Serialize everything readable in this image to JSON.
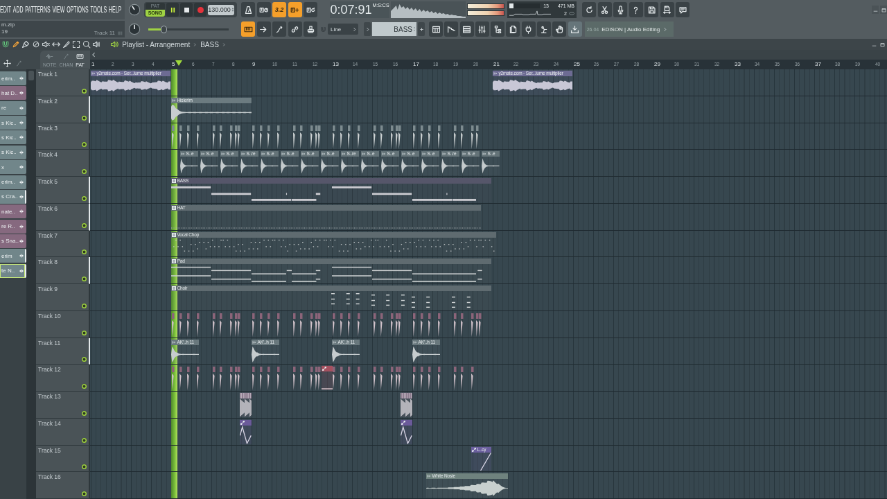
{
  "menu": [
    "EDIT",
    "ADD",
    "PATTERNS",
    "VIEW",
    "OPTIONS",
    "TOOLS",
    "HELP"
  ],
  "hint_panel": {
    "file": "m.zip",
    "line": "19",
    "target": "Track 11"
  },
  "transport": {
    "modes": [
      {
        "label": "PAT",
        "selected": false
      },
      {
        "label": "SONG",
        "selected": true
      }
    ],
    "playing": true,
    "tempo": "130.000"
  },
  "pitch_slider": {
    "level": 0.19
  },
  "record_buttons": [
    {
      "kind": "metronome",
      "on": false
    },
    {
      "kind": "keys-clock",
      "on": false
    },
    {
      "kind": "countdown",
      "label": "3.2",
      "on": true
    },
    {
      "kind": "keys-plus",
      "on": true
    },
    {
      "kind": "keys-loop",
      "on": false
    }
  ],
  "clock": {
    "time": "0:07:91",
    "unit": "M:S:CS"
  },
  "output_meter": [
    {
      "level": 1
    },
    {
      "level": 1
    }
  ],
  "usage": {
    "level": 0.13,
    "cpu": "13",
    "memory": "471 MB",
    "polyphony": "2"
  },
  "edit_buttons": [
    {
      "kind": "keyboard",
      "on": true
    },
    {
      "kind": "arrow",
      "on": false
    },
    {
      "kind": "curve",
      "on": false
    },
    {
      "kind": "link",
      "on": false
    },
    {
      "kind": "stamp",
      "on": false
    }
  ],
  "snap": {
    "value": "Line"
  },
  "pattern_selector": {
    "value": "BASS"
  },
  "view_buttons": [
    {
      "kind": "grid-window",
      "on": false
    },
    {
      "kind": "steps",
      "on": false
    },
    {
      "kind": "rows",
      "on": false
    },
    {
      "kind": "mixer",
      "on": false
    },
    {
      "kind": "folder-tree",
      "on": false
    },
    {
      "kind": "page",
      "on": false
    },
    {
      "kind": "plug",
      "on": false
    },
    {
      "kind": "lamp",
      "on": false
    },
    {
      "kind": "hand",
      "on": false
    },
    {
      "kind": "download",
      "on": true
    }
  ],
  "hint_bar": {
    "time": "26.04",
    "text": "EDISON | Audio Editing"
  },
  "playlist": {
    "title": "Playlist - Arrangement",
    "pattern": "BASS",
    "snap_on": true,
    "tools": [
      {
        "kind": "pencil",
        "selected": true
      },
      {
        "kind": "brush",
        "selected": false
      },
      {
        "kind": "prohibit",
        "selected": false
      },
      {
        "kind": "mute",
        "selected": false
      },
      {
        "kind": "double-arrow",
        "selected": false
      },
      {
        "kind": "knife",
        "selected": false
      },
      {
        "kind": "select",
        "selected": false
      },
      {
        "kind": "magnifier",
        "selected": false
      },
      {
        "kind": "speaker-bars",
        "selected": false
      }
    ],
    "lane_labels": [
      "NOTE",
      "CHAN",
      "PAT"
    ],
    "ruler": [
      "1",
      "2",
      "3",
      "4",
      "5",
      "6",
      "7",
      "8",
      "9",
      "10",
      "11",
      "12",
      "13",
      "14",
      "15",
      "16",
      "17",
      "18",
      "19",
      "20",
      "21",
      "22",
      "23",
      "24",
      "25",
      "26",
      "27",
      "28",
      "29",
      "30",
      "31",
      "32",
      "33",
      "34",
      "35",
      "36",
      "37",
      "38",
      "39",
      "40"
    ]
  },
  "channels": [
    {
      "label": "erim..",
      "color": "#71868a",
      "selected": false,
      "focused": false
    },
    {
      "label": "hat D..",
      "color": "#86697f",
      "selected": false,
      "focused": false
    },
    {
      "label": "re",
      "color": "#71868a",
      "selected": false,
      "focused": false
    },
    {
      "label": "s Kic..",
      "color": "#71868a",
      "selected": false,
      "focused": false
    },
    {
      "label": "s Kic..",
      "color": "#71868a",
      "selected": false,
      "focused": false
    },
    {
      "label": "s Kic..",
      "color": "#71868a",
      "selected": false,
      "focused": false
    },
    {
      "label": "x",
      "color": "#71868a",
      "selected": false,
      "focused": false
    },
    {
      "label": "erim..",
      "color": "#71868a",
      "selected": false,
      "focused": false
    },
    {
      "label": "s Cra..",
      "color": "#71868a",
      "selected": true,
      "focused": false
    },
    {
      "label": "nate..",
      "color": "#86697f",
      "selected": false,
      "focused": false
    },
    {
      "label": "re R..",
      "color": "#86697f",
      "selected": false,
      "focused": false
    },
    {
      "label": "s Sna..",
      "color": "#86697f",
      "selected": false,
      "focused": false
    },
    {
      "label": "erim",
      "color": "#71868a",
      "selected": true,
      "focused": false
    },
    {
      "label": "te N..",
      "color": "#71868a",
      "selected": true,
      "focused": true
    }
  ],
  "tracks": [
    {
      "name": "Track 1",
      "marker": false,
      "enabled": true,
      "clips": [
        {
          "kind": "audio",
          "label": "y2mate.com - Ser...lume multiplier",
          "color": "#6d6b93"
        },
        {
          "kind": "audio",
          "label": "y2mate.com - Ser...lume multiplier",
          "color": "#6d6b93"
        }
      ]
    },
    {
      "name": "Track 2",
      "marker": true,
      "enabled": true,
      "clips": [
        {
          "kind": "audio",
          "label": "Hislerim",
          "color": "#6c7b80"
        }
      ]
    },
    {
      "name": "Track 3",
      "marker": false,
      "enabled": true,
      "clips": [
        {
          "kind": "hits",
          "color": "#7d8b8f"
        }
      ]
    },
    {
      "name": "Track 4",
      "marker": false,
      "enabled": true,
      "clips": [
        {
          "kind": "audio",
          "label": "S..e",
          "color": "#647378"
        },
        {
          "kind": "audio",
          "label": "S..e",
          "color": "#647378"
        },
        {
          "kind": "audio",
          "label": "S..e",
          "color": "#647378"
        },
        {
          "kind": "audio",
          "label": "S..re",
          "color": "#647378"
        },
        {
          "kind": "audio",
          "label": "S..e",
          "color": "#647378"
        },
        {
          "kind": "audio",
          "label": "S..e",
          "color": "#647378"
        },
        {
          "kind": "audio",
          "label": "S..e",
          "color": "#647378"
        },
        {
          "kind": "audio",
          "label": "S..e",
          "color": "#647378"
        },
        {
          "kind": "audio",
          "label": "S..re",
          "color": "#647378"
        },
        {
          "kind": "audio",
          "label": "S..e",
          "color": "#647378"
        },
        {
          "kind": "audio",
          "label": "S..e",
          "color": "#647378"
        },
        {
          "kind": "audio",
          "label": "S..e",
          "color": "#647378"
        },
        {
          "kind": "audio",
          "label": "S..e",
          "color": "#647378"
        },
        {
          "kind": "audio",
          "label": "S..re",
          "color": "#647378"
        },
        {
          "kind": "audio",
          "label": "S..e",
          "color": "#647378"
        },
        {
          "kind": "audio",
          "label": "S..e",
          "color": "#647378"
        }
      ]
    },
    {
      "name": "Track 5",
      "marker": true,
      "enabled": true,
      "clips": [
        {
          "kind": "pattern",
          "label": "BASS",
          "color": "#56566a"
        }
      ]
    },
    {
      "name": "Track 6",
      "marker": true,
      "enabled": true,
      "clips": [
        {
          "kind": "pattern",
          "label": "HAT",
          "color": "#5f6b70"
        }
      ]
    },
    {
      "name": "Track 7",
      "marker": false,
      "enabled": true,
      "clips": [
        {
          "kind": "pattern",
          "label": "Vocal Chop",
          "color": "#5f6b70"
        }
      ]
    },
    {
      "name": "Track 8",
      "marker": true,
      "enabled": true,
      "clips": [
        {
          "kind": "pattern",
          "label": "Pad",
          "color": "#5f6b70"
        }
      ]
    },
    {
      "name": "Track 9",
      "marker": false,
      "enabled": true,
      "clips": [
        {
          "kind": "pattern",
          "label": "Choir",
          "color": "#5f6b70"
        }
      ]
    },
    {
      "name": "Track 10",
      "marker": false,
      "enabled": true,
      "clips": [
        {
          "kind": "hits",
          "color": "#8c6479"
        }
      ]
    },
    {
      "name": "Track 11",
      "marker": true,
      "enabled": true,
      "clips": [
        {
          "kind": "audio",
          "label": "AK'..h 11",
          "color": "#69787d"
        },
        {
          "kind": "audio",
          "label": "AK'..h 11",
          "color": "#69787d"
        },
        {
          "kind": "audio",
          "label": "AK'..h 11",
          "color": "#69787d"
        },
        {
          "kind": "audio",
          "label": "AK'..h 11",
          "color": "#69787d"
        }
      ]
    },
    {
      "name": "Track 12",
      "marker": false,
      "enabled": true,
      "clips": [
        {
          "kind": "hits",
          "color": "#8c6479"
        },
        {
          "kind": "automation",
          "color": "#a4505f"
        }
      ]
    },
    {
      "name": "Track 13",
      "marker": false,
      "enabled": true,
      "clips": [
        {
          "kind": "slices",
          "color": "#8e7d90"
        },
        {
          "kind": "slices",
          "color": "#8e7d90"
        }
      ]
    },
    {
      "name": "Track 14",
      "marker": false,
      "enabled": true,
      "clips": [
        {
          "kind": "automation",
          "color": "#6b5a9a"
        },
        {
          "kind": "automation",
          "color": "#6b5a9a"
        }
      ]
    },
    {
      "name": "Track 15",
      "marker": false,
      "enabled": true,
      "clips": [
        {
          "kind": "automation",
          "label": "L..cy",
          "color": "#6b5f9e"
        }
      ]
    },
    {
      "name": "Track 16",
      "marker": false,
      "enabled": true,
      "clips": [
        {
          "kind": "audio",
          "label": "White Nosie",
          "color": "#6f827e"
        }
      ]
    }
  ]
}
